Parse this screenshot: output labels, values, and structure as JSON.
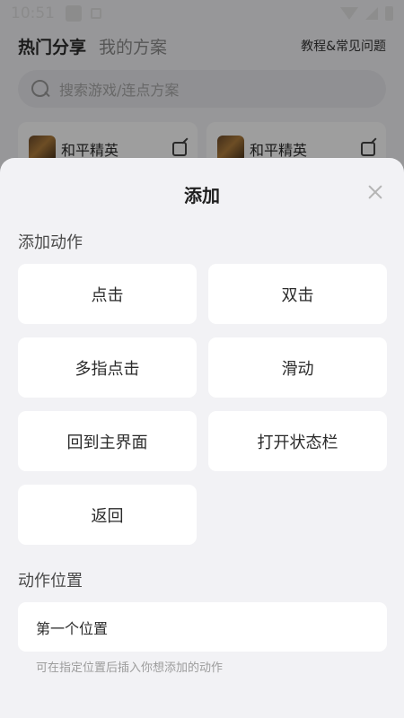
{
  "status_bar": {
    "time": "10:51"
  },
  "background": {
    "tabs": [
      "热门分享",
      "我的方案"
    ],
    "help_link": "教程&常见问题",
    "search_placeholder": "搜索游戏/连点方案",
    "cards": [
      {
        "name": "和平精英"
      },
      {
        "name": "和平精英"
      }
    ]
  },
  "sheet": {
    "title": "添加",
    "actions_label": "添加动作",
    "actions": [
      "点击",
      "双击",
      "多指点击",
      "滑动",
      "回到主界面",
      "打开状态栏",
      "返回"
    ],
    "position_label": "动作位置",
    "position_value": "第一个位置",
    "position_hint": "可在指定位置后插入你想添加的动作"
  }
}
